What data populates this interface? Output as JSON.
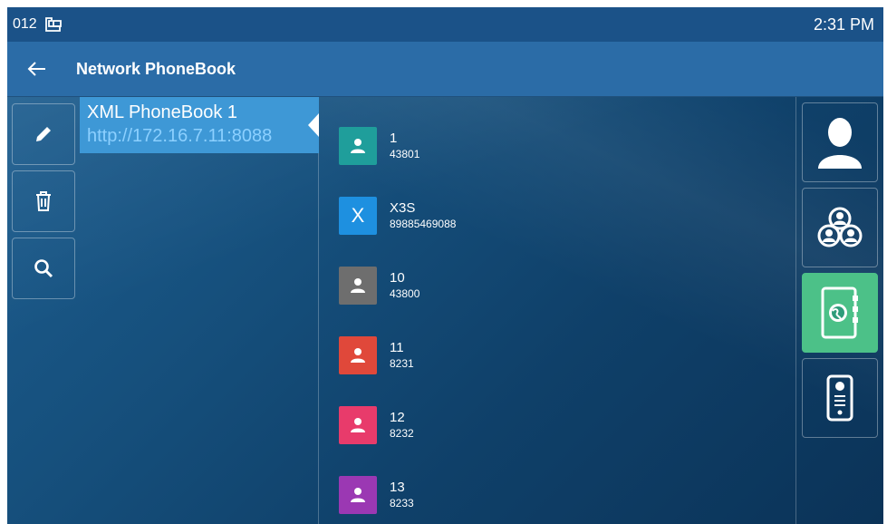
{
  "status_bar": {
    "extension": "012",
    "time": "2:31 PM"
  },
  "header": {
    "title": "Network PhoneBook"
  },
  "left_toolbar": {
    "items": [
      {
        "icon": "pencil-icon"
      },
      {
        "icon": "trash-icon"
      },
      {
        "icon": "search-icon"
      }
    ]
  },
  "phonebooks": [
    {
      "name": "XML PhoneBook 1",
      "url": "http://172.16.7.11:8088",
      "selected": true
    }
  ],
  "contacts": [
    {
      "name": "1",
      "number": "43801",
      "avatar_color": "#1f9e9b",
      "avatar_icon": "person-icon"
    },
    {
      "name": "X3S",
      "number": "89885469088",
      "avatar_color": "#1e90e0",
      "avatar_glyph": "X"
    },
    {
      "name": "10",
      "number": "43800",
      "avatar_color": "#6e6e6e",
      "avatar_icon": "person-icon"
    },
    {
      "name": "11",
      "number": "8231",
      "avatar_color": "#e0483a",
      "avatar_icon": "person-icon"
    },
    {
      "name": "12",
      "number": "8232",
      "avatar_color": "#e83b6b",
      "avatar_icon": "person-icon"
    },
    {
      "name": "13",
      "number": "8233",
      "avatar_color": "#9b38b3",
      "avatar_icon": "person-icon"
    }
  ],
  "right_nav": {
    "items": [
      {
        "icon": "contact-icon",
        "active": false
      },
      {
        "icon": "group-icon",
        "active": false
      },
      {
        "icon": "network-phonebook-icon",
        "active": true
      },
      {
        "icon": "intercom-device-icon",
        "active": false
      }
    ],
    "active_color": "#4cc188"
  }
}
